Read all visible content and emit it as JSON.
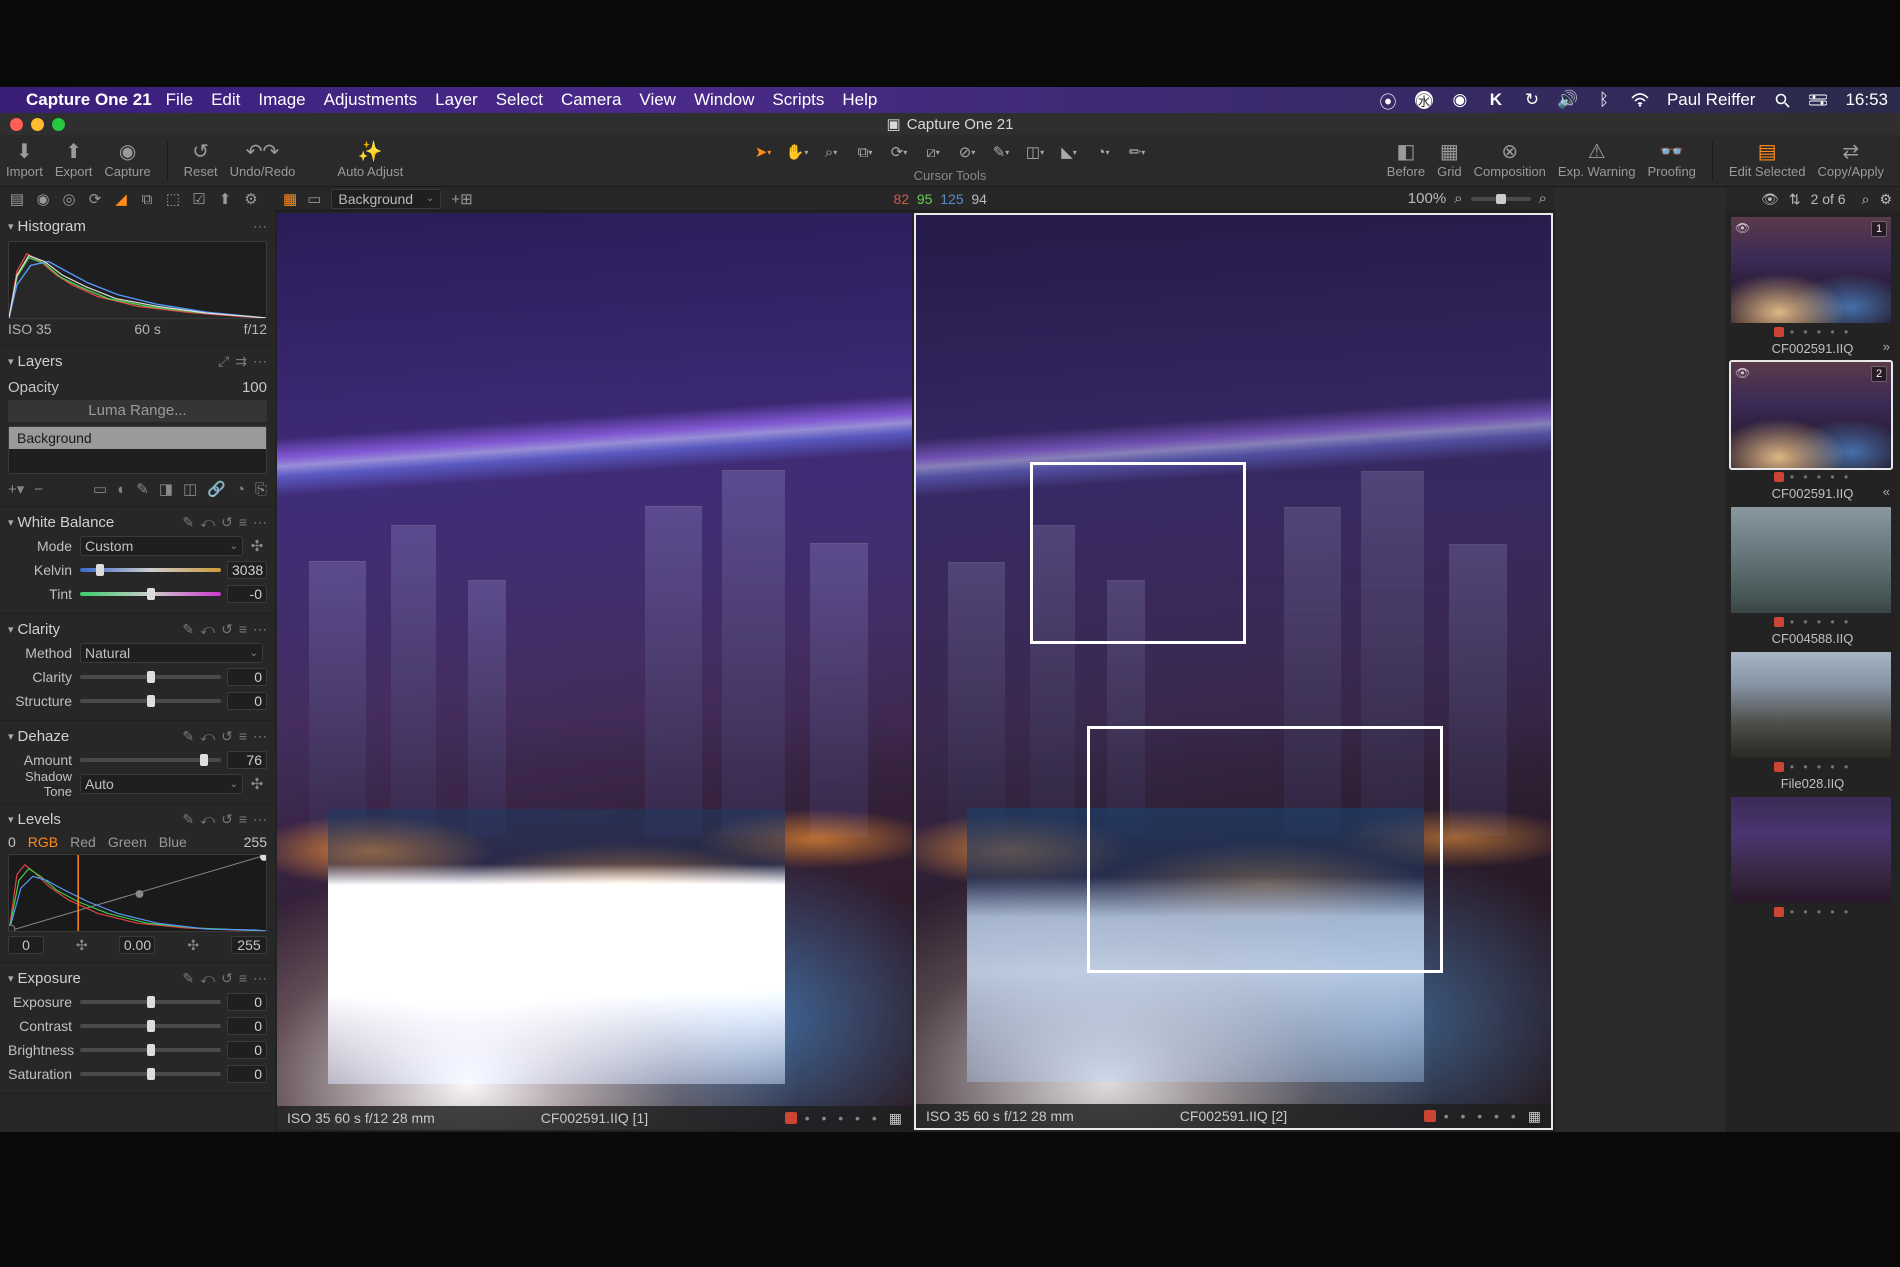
{
  "menubar": {
    "app": "Capture One 21",
    "items": [
      "File",
      "Edit",
      "Image",
      "Adjustments",
      "Layer",
      "Select",
      "Camera",
      "View",
      "Window",
      "Scripts",
      "Help"
    ],
    "user": "Paul Reiffer",
    "clock": "16:53"
  },
  "window": {
    "title": "Capture One 21"
  },
  "toolbar": {
    "left": [
      {
        "key": "import",
        "label": "Import"
      },
      {
        "key": "export",
        "label": "Export"
      },
      {
        "key": "capture",
        "label": "Capture"
      }
    ],
    "mid": [
      {
        "key": "reset",
        "label": "Reset"
      },
      {
        "key": "undoredo",
        "label": "Undo/Redo"
      },
      {
        "key": "autoadjust",
        "label": "Auto Adjust"
      }
    ],
    "cursor_label": "Cursor Tools",
    "right": [
      {
        "key": "before",
        "label": "Before"
      },
      {
        "key": "grid",
        "label": "Grid"
      },
      {
        "key": "composition",
        "label": "Composition"
      },
      {
        "key": "expwarning",
        "label": "Exp. Warning"
      },
      {
        "key": "proofing",
        "label": "Proofing"
      }
    ],
    "far_right": [
      {
        "key": "editselected",
        "label": "Edit Selected"
      },
      {
        "key": "copyapply",
        "label": "Copy/Apply"
      }
    ]
  },
  "viewstrip": {
    "layer_select": "Background",
    "rgb": {
      "r": "82",
      "g": "95",
      "b": "125",
      "a": "94"
    },
    "zoom": "100%"
  },
  "browserbar": {
    "count": "2 of 6"
  },
  "panels": {
    "histogram": {
      "title": "Histogram",
      "iso": "ISO 35",
      "shutter": "60 s",
      "aperture": "f/12"
    },
    "layers": {
      "title": "Layers",
      "opacity_label": "Opacity",
      "opacity": "100",
      "luma": "Luma Range...",
      "active": "Background"
    },
    "wb": {
      "title": "White Balance",
      "mode_label": "Mode",
      "mode": "Custom",
      "kelvin_label": "Kelvin",
      "kelvin": "3038",
      "tint_label": "Tint",
      "tint": "-0"
    },
    "clarity": {
      "title": "Clarity",
      "method_label": "Method",
      "method": "Natural",
      "clarity_label": "Clarity",
      "clarity": "0",
      "structure_label": "Structure",
      "structure": "0"
    },
    "dehaze": {
      "title": "Dehaze",
      "amount_label": "Amount",
      "amount": "76",
      "shadow_label": "Shadow Tone",
      "shadow": "Auto"
    },
    "levels": {
      "title": "Levels",
      "tabs": [
        "RGB",
        "Red",
        "Green",
        "Blue"
      ],
      "low": "0",
      "high": "255",
      "shadow": "0",
      "mid": "0.00",
      "highlight": "255"
    },
    "exposure": {
      "title": "Exposure",
      "exposure_label": "Exposure",
      "exposure": "0",
      "contrast_label": "Contrast",
      "contrast": "0",
      "brightness_label": "Brightness",
      "brightness": "0",
      "saturation_label": "Saturation",
      "saturation": "0"
    }
  },
  "viewer": {
    "left": {
      "info": "ISO 35   60 s   f/12   28 mm",
      "name": "CF002591.IIQ [1]"
    },
    "right": {
      "info": "ISO 35   60 s   f/12   28 mm",
      "name": "CF002591.IIQ [2]"
    }
  },
  "browser": {
    "thumbs": [
      {
        "name": "CF002591.IIQ",
        "variant": "1",
        "scene": "scene-city",
        "nav": "»"
      },
      {
        "name": "CF002591.IIQ",
        "variant": "2",
        "scene": "scene-city",
        "selected": true,
        "nav": "«"
      },
      {
        "name": "CF004588.IIQ",
        "scene": "scene-fog"
      },
      {
        "name": "File028.IIQ",
        "scene": "scene-wall"
      },
      {
        "name": "",
        "scene": "scene-city2"
      }
    ]
  }
}
